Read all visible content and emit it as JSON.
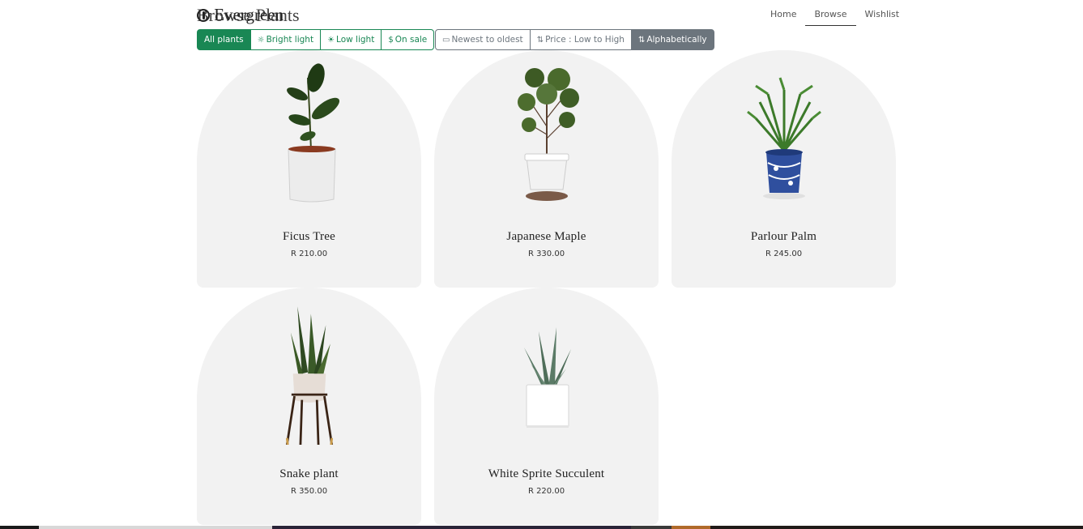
{
  "brand": {
    "logo_text": "Evergreen",
    "page_title": "Browse Plants"
  },
  "nav": {
    "items": [
      {
        "label": "Home"
      },
      {
        "label": "Browse"
      },
      {
        "label": "Wishlist"
      }
    ],
    "active": "Browse"
  },
  "filters": {
    "items": [
      {
        "label": "All plants",
        "icon": ""
      },
      {
        "label": "Bright light",
        "icon": "sun-icon"
      },
      {
        "label": "Low light",
        "icon": "dim-sun-icon"
      },
      {
        "label": "On sale",
        "icon": "dollar-icon"
      }
    ],
    "active": "All plants",
    "accent_color": "#198754"
  },
  "sorts": {
    "items": [
      {
        "label": "Newest to oldest",
        "icon": "calendar-icon"
      },
      {
        "label": "Price : Low to High",
        "icon": "sort-numeric-icon"
      },
      {
        "label": "Alphabetically",
        "icon": "sort-alpha-icon"
      }
    ],
    "active": "Alphabetically",
    "accent_color": "#6c757d"
  },
  "products": [
    {
      "name": "Ficus Tree",
      "price": "R 210.00",
      "image": "ficus-plant-image"
    },
    {
      "name": "Japanese Maple",
      "price": "R 330.00",
      "image": "japanese-maple-plant-image"
    },
    {
      "name": "Parlour Palm",
      "price": "R 245.00",
      "image": "parlour-palm-plant-image"
    },
    {
      "name": "Snake plant",
      "price": "R 350.00",
      "image": "snake-plant-image"
    },
    {
      "name": "White Sprite Succulent",
      "price": "R 220.00",
      "image": "succulent-plant-image"
    }
  ],
  "colors": {
    "card_background": "#f2f2f2",
    "text": "#222222"
  }
}
